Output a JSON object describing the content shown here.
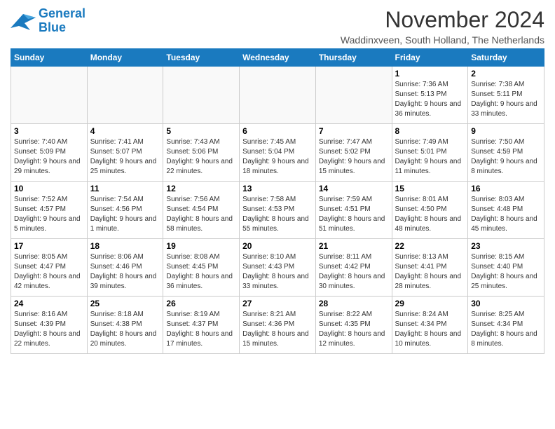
{
  "logo": {
    "line1": "General",
    "line2": "Blue"
  },
  "title": "November 2024",
  "location": "Waddinxveen, South Holland, The Netherlands",
  "days_of_week": [
    "Sunday",
    "Monday",
    "Tuesday",
    "Wednesday",
    "Thursday",
    "Friday",
    "Saturday"
  ],
  "weeks": [
    [
      {
        "day": "",
        "info": ""
      },
      {
        "day": "",
        "info": ""
      },
      {
        "day": "",
        "info": ""
      },
      {
        "day": "",
        "info": ""
      },
      {
        "day": "",
        "info": ""
      },
      {
        "day": "1",
        "info": "Sunrise: 7:36 AM\nSunset: 5:13 PM\nDaylight: 9 hours and 36 minutes."
      },
      {
        "day": "2",
        "info": "Sunrise: 7:38 AM\nSunset: 5:11 PM\nDaylight: 9 hours and 33 minutes."
      }
    ],
    [
      {
        "day": "3",
        "info": "Sunrise: 7:40 AM\nSunset: 5:09 PM\nDaylight: 9 hours and 29 minutes."
      },
      {
        "day": "4",
        "info": "Sunrise: 7:41 AM\nSunset: 5:07 PM\nDaylight: 9 hours and 25 minutes."
      },
      {
        "day": "5",
        "info": "Sunrise: 7:43 AM\nSunset: 5:06 PM\nDaylight: 9 hours and 22 minutes."
      },
      {
        "day": "6",
        "info": "Sunrise: 7:45 AM\nSunset: 5:04 PM\nDaylight: 9 hours and 18 minutes."
      },
      {
        "day": "7",
        "info": "Sunrise: 7:47 AM\nSunset: 5:02 PM\nDaylight: 9 hours and 15 minutes."
      },
      {
        "day": "8",
        "info": "Sunrise: 7:49 AM\nSunset: 5:01 PM\nDaylight: 9 hours and 11 minutes."
      },
      {
        "day": "9",
        "info": "Sunrise: 7:50 AM\nSunset: 4:59 PM\nDaylight: 9 hours and 8 minutes."
      }
    ],
    [
      {
        "day": "10",
        "info": "Sunrise: 7:52 AM\nSunset: 4:57 PM\nDaylight: 9 hours and 5 minutes."
      },
      {
        "day": "11",
        "info": "Sunrise: 7:54 AM\nSunset: 4:56 PM\nDaylight: 9 hours and 1 minute."
      },
      {
        "day": "12",
        "info": "Sunrise: 7:56 AM\nSunset: 4:54 PM\nDaylight: 8 hours and 58 minutes."
      },
      {
        "day": "13",
        "info": "Sunrise: 7:58 AM\nSunset: 4:53 PM\nDaylight: 8 hours and 55 minutes."
      },
      {
        "day": "14",
        "info": "Sunrise: 7:59 AM\nSunset: 4:51 PM\nDaylight: 8 hours and 51 minutes."
      },
      {
        "day": "15",
        "info": "Sunrise: 8:01 AM\nSunset: 4:50 PM\nDaylight: 8 hours and 48 minutes."
      },
      {
        "day": "16",
        "info": "Sunrise: 8:03 AM\nSunset: 4:48 PM\nDaylight: 8 hours and 45 minutes."
      }
    ],
    [
      {
        "day": "17",
        "info": "Sunrise: 8:05 AM\nSunset: 4:47 PM\nDaylight: 8 hours and 42 minutes."
      },
      {
        "day": "18",
        "info": "Sunrise: 8:06 AM\nSunset: 4:46 PM\nDaylight: 8 hours and 39 minutes."
      },
      {
        "day": "19",
        "info": "Sunrise: 8:08 AM\nSunset: 4:45 PM\nDaylight: 8 hours and 36 minutes."
      },
      {
        "day": "20",
        "info": "Sunrise: 8:10 AM\nSunset: 4:43 PM\nDaylight: 8 hours and 33 minutes."
      },
      {
        "day": "21",
        "info": "Sunrise: 8:11 AM\nSunset: 4:42 PM\nDaylight: 8 hours and 30 minutes."
      },
      {
        "day": "22",
        "info": "Sunrise: 8:13 AM\nSunset: 4:41 PM\nDaylight: 8 hours and 28 minutes."
      },
      {
        "day": "23",
        "info": "Sunrise: 8:15 AM\nSunset: 4:40 PM\nDaylight: 8 hours and 25 minutes."
      }
    ],
    [
      {
        "day": "24",
        "info": "Sunrise: 8:16 AM\nSunset: 4:39 PM\nDaylight: 8 hours and 22 minutes."
      },
      {
        "day": "25",
        "info": "Sunrise: 8:18 AM\nSunset: 4:38 PM\nDaylight: 8 hours and 20 minutes."
      },
      {
        "day": "26",
        "info": "Sunrise: 8:19 AM\nSunset: 4:37 PM\nDaylight: 8 hours and 17 minutes."
      },
      {
        "day": "27",
        "info": "Sunrise: 8:21 AM\nSunset: 4:36 PM\nDaylight: 8 hours and 15 minutes."
      },
      {
        "day": "28",
        "info": "Sunrise: 8:22 AM\nSunset: 4:35 PM\nDaylight: 8 hours and 12 minutes."
      },
      {
        "day": "29",
        "info": "Sunrise: 8:24 AM\nSunset: 4:34 PM\nDaylight: 8 hours and 10 minutes."
      },
      {
        "day": "30",
        "info": "Sunrise: 8:25 AM\nSunset: 4:34 PM\nDaylight: 8 hours and 8 minutes."
      }
    ]
  ]
}
